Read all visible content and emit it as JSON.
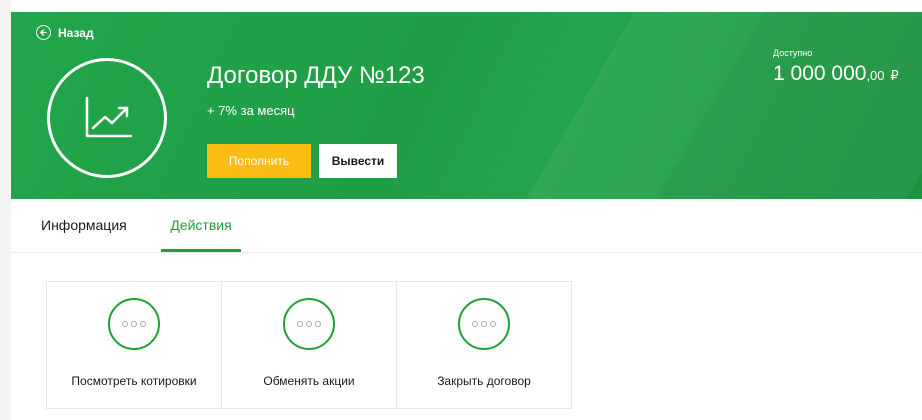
{
  "header": {
    "back_label": "Назад",
    "title": "Договор ДДУ №123",
    "subtitle": "+ 7% за месяц",
    "available_label": "Доступно",
    "available_amount_main": "1 000 000",
    "available_amount_cents": ",00",
    "currency_symbol": "₽",
    "topup_label": "Пополнить",
    "withdraw_label": "Вывести",
    "icon": "trend-chart-icon"
  },
  "tabs": [
    {
      "label": "Информация",
      "active": false
    },
    {
      "label": "Действия",
      "active": true
    }
  ],
  "actions": [
    {
      "label": "Посмотреть котировки",
      "icon": "more-dots-icon"
    },
    {
      "label": "Обменять акции",
      "icon": "more-dots-icon"
    },
    {
      "label": "Закрыть договор",
      "icon": "more-dots-icon"
    }
  ],
  "colors": {
    "brand_green": "#21a038",
    "banner_green": "#22a54a",
    "accent_yellow": "#fbbd13"
  }
}
